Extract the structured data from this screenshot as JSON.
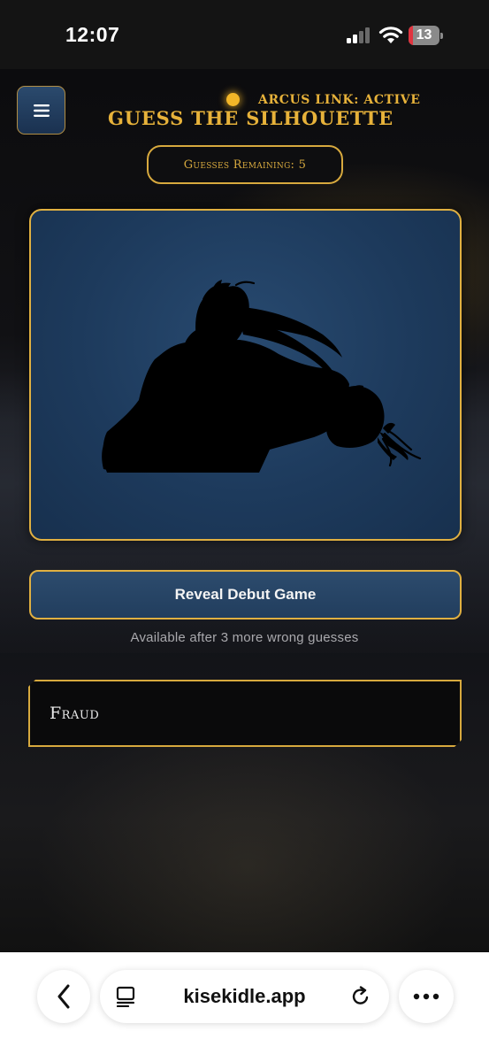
{
  "status_bar": {
    "time": "12:07",
    "battery_level": "13",
    "battery_fraction": 0.13,
    "icons": [
      "cellular-signal-icon",
      "wifi-icon",
      "battery-icon"
    ]
  },
  "header": {
    "menu_icon": "hamburger-menu-icon",
    "link_status": "ARCUS LINK: ACTIVE",
    "title": "GUESS THE SILHOUETTE"
  },
  "game": {
    "guesses_remaining_label": "Guesses Remaining: 5",
    "reveal_button_label": "Reveal Debut Game",
    "reveal_hint": "Available after 3 more wrong guesses",
    "guesses": [
      "Fraud"
    ]
  },
  "browser": {
    "url": "kisekidle.app",
    "icons": [
      "back-chevron-icon",
      "tabs-icon",
      "reload-icon",
      "more-icon"
    ]
  },
  "colors": {
    "accent_gold": "#e0b041",
    "card_blue": "#1d3a5c",
    "battery_low": "#e0343f"
  }
}
